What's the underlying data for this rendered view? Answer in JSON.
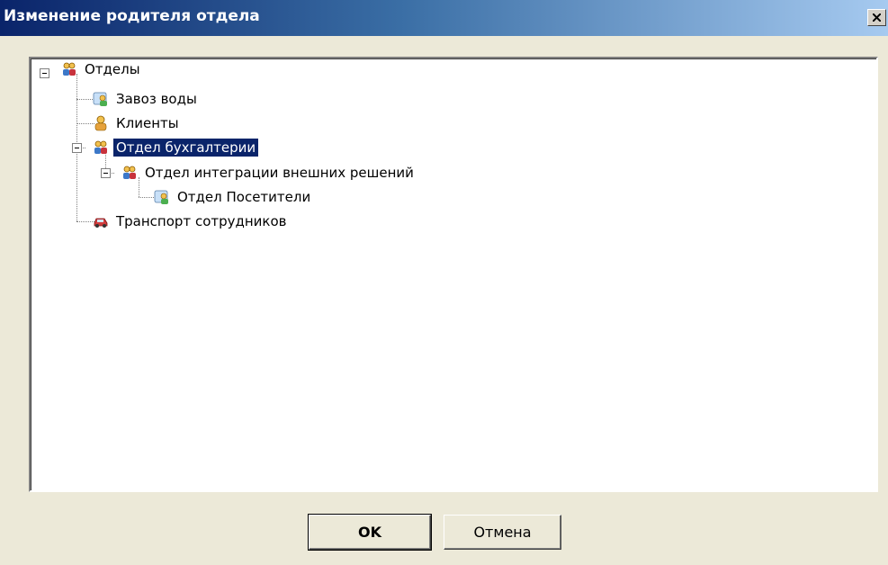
{
  "window": {
    "title": "Изменение родителя отдела",
    "close_symbol": "×"
  },
  "tree": {
    "root": {
      "label": "Отделы",
      "icon": "people-group-icon"
    },
    "items": [
      {
        "label": "Завоз воды",
        "icon": "user-card-icon"
      },
      {
        "label": "Клиенты",
        "icon": "person-icon"
      },
      {
        "label": "Отдел бухгалтерии",
        "icon": "people-group-icon",
        "selected": true
      },
      {
        "label": "Отдел интеграции внешних решений",
        "icon": "people-group-icon"
      },
      {
        "label": "Отдел Посетители",
        "icon": "user-card-icon"
      },
      {
        "label": "Транспорт сотрудников",
        "icon": "car-icon"
      }
    ]
  },
  "buttons": {
    "ok": "OK",
    "cancel": "Отмена"
  },
  "colors": {
    "selection": "#0a246a",
    "title_start": "#0a246a",
    "title_end": "#a6caf0",
    "face": "#ece9d8"
  }
}
